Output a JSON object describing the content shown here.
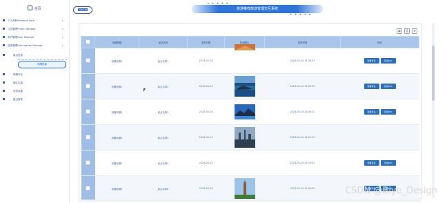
{
  "sidebar": {
    "brand": "主页",
    "items": [
      {
        "label": "个人资料Personal data",
        "icon": "user-icon",
        "chevron": "∨"
      },
      {
        "label": "公告管理Public Manage",
        "icon": "notice-icon",
        "chevron": "∨"
      },
      {
        "label": "用户管理User Manage",
        "icon": "users-icon",
        "chevron": "∨"
      },
      {
        "label": "信息管理Information Manage",
        "icon": "info-icon",
        "chevron": "∨"
      }
    ],
    "sub_items": [
      {
        "label": "景点信息",
        "icon": "list-icon"
      },
      {
        "label": "攻略信息",
        "icon": "list-icon",
        "active": true
      },
      {
        "label": "攻略评论",
        "icon": "comment-icon"
      },
      {
        "label": "景区实施",
        "icon": "facility-icon"
      },
      {
        "label": "系统设置",
        "icon": "settings-icon"
      },
      {
        "label": "退出登录",
        "icon": "logout-icon"
      }
    ]
  },
  "header": {
    "left_pill": "切换系统",
    "title": "旅游推荐旅游管理交互系统",
    "stars": "★ ★ ★ ★ ★"
  },
  "toolbar": {
    "icons": [
      "table-icon",
      "print-icon",
      "gear-icon"
    ]
  },
  "table": {
    "columns": [
      "攻略标题",
      "景点名称",
      "发布日期",
      "封面图片",
      "发布时间",
      "操作"
    ],
    "rows": [
      {
        "title": "攻略标题1",
        "spot": "景点名称1",
        "date": "2023-04-24",
        "time": "2023-04-24 15:20:52",
        "img": "red-roof"
      },
      {
        "title": "攻略标题2",
        "spot": "景点名称2",
        "date": "2023-04-24",
        "time": "2023-04-24 15:20:52",
        "img": "sea"
      },
      {
        "title": "攻略标题3",
        "spot": "景点名称3",
        "date": "2023-04-24",
        "time": "2023-04-24 15:20:52",
        "img": "mountain"
      },
      {
        "title": "攻略标题4",
        "spot": "景点名称4",
        "date": "2023-04-24",
        "time": "2023-04-24 15:20:52",
        "img": "city"
      },
      {
        "title": "攻略标题5",
        "spot": "景点名称5",
        "date": "2023-04-24",
        "time": "2023-04-24 15:20:52",
        "img": "none"
      },
      {
        "title": "攻略标题6",
        "spot": "景点名称6",
        "date": "2023-04-24",
        "time": "2023-04-24 15:20:52",
        "img": "pagoda"
      }
    ],
    "buttons": [
      "查看评论",
      "评论Edit"
    ]
  },
  "watermark": "CSDN @Biye_Design",
  "colors": {
    "accent": "#2f6fb5",
    "header": "#a9c6ea"
  }
}
